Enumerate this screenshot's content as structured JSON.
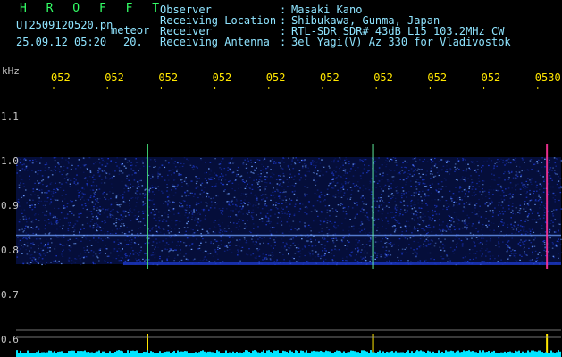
{
  "app": {
    "title": "H R O F F T",
    "filename": "UT2509120520.pn",
    "meteor_label": "meteor",
    "datetime": "25.09.12 05:20",
    "count": "20."
  },
  "info": {
    "rows": [
      {
        "label": "Observer",
        "sep": ":",
        "value": "Masaki Kano"
      },
      {
        "label": "Receiving Location",
        "sep": ":",
        "value": "Shibukawa, Gunma, Japan"
      },
      {
        "label": "Receiver",
        "sep": ":",
        "value": "RTL-SDR SDR# 43dB L15 103.2MHz CW"
      },
      {
        "label": "Receiving Antenna",
        "sep": ":",
        "value": "3el Yagi(V) Az 330 for Vladivostok"
      }
    ]
  },
  "chart_data": {
    "type": "heatmap",
    "title": "",
    "ylabel": "kHz",
    "yticks": [
      "1.1",
      "1.0",
      "0.9",
      "0.8",
      "0.7",
      "0.6"
    ],
    "xtick_labels": [
      "052",
      "052",
      "052",
      "052",
      "052",
      "052",
      "052",
      "052",
      "052",
      "0530"
    ],
    "ylim": [
      0.58,
      1.15
    ],
    "signal_band": [
      0.77,
      1.01
    ],
    "carrier_line_khz": 0.835,
    "echo_streaks": [
      {
        "x_fraction": 0.241,
        "color": "#44dd77"
      },
      {
        "x_fraction": 0.655,
        "color": "#66ffaa"
      },
      {
        "x_fraction": 0.974,
        "color": "#ff3399"
      }
    ],
    "colors": {
      "background": "#000000",
      "noise_dark": "#0a1a6a",
      "noise_mid": "#1c38c8",
      "noise_bright": "#6fa0ff",
      "tick": "#ffe600",
      "baseline": "#00e5ff"
    }
  }
}
